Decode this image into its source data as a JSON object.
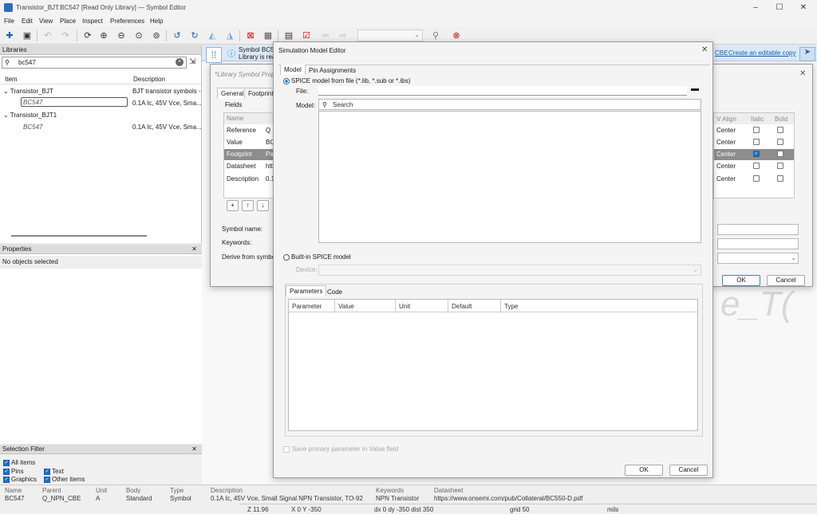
{
  "window": {
    "title": "Transistor_BJT:BC547 [Read Only Library] — Symbol Editor"
  },
  "menu": [
    "File",
    "Edit",
    "View",
    "Place",
    "Inspect",
    "Preferences",
    "Help"
  ],
  "libraries": {
    "title": "Libraries",
    "search_value": "bc547",
    "col_item": "Item",
    "col_desc": "Description",
    "rows": [
      {
        "item": "Transistor_BJT",
        "desc": "BJT transistor symbols -"
      },
      {
        "item": "BC547",
        "desc": "0.1A Ic, 45V Vce, Sma...P"
      },
      {
        "item": "Transistor_BJT1",
        "desc": ""
      },
      {
        "item": "BC547",
        "desc": "0.1A Ic, 45V Vce, Sma...P"
      }
    ]
  },
  "properties": {
    "title": "Properties",
    "empty": "No objects selected"
  },
  "selection_filter": {
    "title": "Selection Filter",
    "all": "All items",
    "pins": "Pins",
    "text": "Text",
    "graphics": "Graphics",
    "other": "Other items"
  },
  "infobar": {
    "line1": "Symbol BC5",
    "line2": "Library is rea",
    "cbe": "CBE",
    "link": "Create an editable copy"
  },
  "canvas_text": "e_T(",
  "libprops": {
    "title": "*Library Symbol Prop",
    "tabs": [
      "General",
      "Footprint"
    ],
    "fields_label": "Fields",
    "rows": [
      {
        "name": "Name",
        "val": ""
      },
      {
        "name": "Reference",
        "val": "Q"
      },
      {
        "name": "Value",
        "val": "BC"
      },
      {
        "name": "Footprint",
        "val": "Pa"
      },
      {
        "name": "Datasheet",
        "val": "htt"
      },
      {
        "name": "Description",
        "val": "0.1"
      }
    ],
    "symbol_name": "Symbol name:",
    "keywords": "Keywords:",
    "derive": "Derive from symbo",
    "right_cols": [
      "V Align",
      "Italic",
      "Bold"
    ],
    "right_rows": [
      "Center",
      "Center",
      "Center",
      "Center",
      "Center"
    ],
    "ok": "OK",
    "cancel": "Cancel"
  },
  "sim": {
    "title": "Simulation Model Editor",
    "tabs": [
      "Model",
      "Pin Assignments"
    ],
    "spice_file": "SPICE model from file (*.lib, *.sub or *.ibs)",
    "file_label": "File:",
    "model_label": "Model:",
    "search_placeholder": "Search",
    "builtin": "Built-in SPICE model",
    "device_label": "Device:",
    "param_tabs": [
      "Parameters",
      "Code"
    ],
    "param_cols": [
      "Parameter",
      "Value",
      "Unit",
      "Default",
      "Type"
    ],
    "save_primary": "Save primary parameter in Value field",
    "ok": "OK",
    "cancel": "Cancel"
  },
  "bottom": {
    "h_name": "Name",
    "h_parent": "Parent",
    "h_unit": "Unit",
    "h_body": "Body",
    "h_type": "Type",
    "h_desc": "Description",
    "h_kw": "Keywords",
    "h_ds": "Datasheet",
    "name": "BC547",
    "parent": "Q_NPN_CBE",
    "unit": "A",
    "body": "Standard",
    "type": "Symbol",
    "desc": "0.1A Ic, 45V Vce, Small Signal NPN Transistor, TO-92",
    "kw": "NPN Transistor",
    "ds": "https://www.onsemi.com/pub/Collateral/BC550-D.pdf",
    "zoom": "Z 11.96",
    "xy": "X 0  Y -350",
    "dxy": "dx 0  dy -350  dist 350",
    "grid": "grid 50",
    "units": "mils"
  }
}
